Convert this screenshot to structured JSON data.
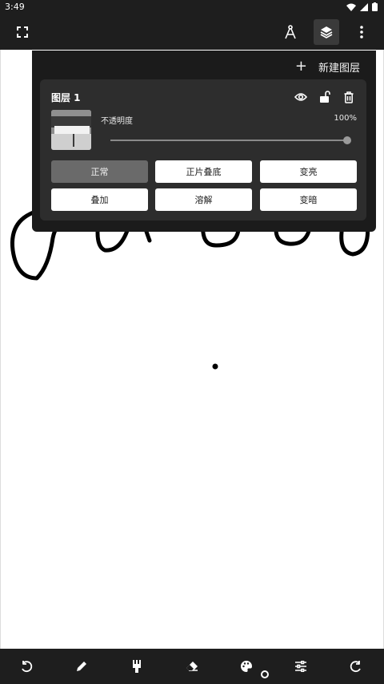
{
  "status_bar": {
    "time": "3:49"
  },
  "top_bar": {
    "fullscreen_icon": "fullscreen-icon",
    "compass_icon": "compass-icon",
    "layers_icon": "layers-icon",
    "more_icon": "more-vert-icon"
  },
  "layers_panel": {
    "new_layer_label": "新建图层",
    "new_layer_icon": "+",
    "layer": {
      "name": "图层 1",
      "opacity_label": "不透明度",
      "opacity_value": "100%",
      "opacity": 1.0,
      "visible_icon": "eye-icon",
      "lock_icon": "lock-open-icon",
      "delete_icon": "trash-icon"
    },
    "blend_modes": [
      {
        "label": "正常",
        "selected": true
      },
      {
        "label": "正片叠底",
        "selected": false
      },
      {
        "label": "变亮",
        "selected": false
      },
      {
        "label": "叠加",
        "selected": false
      },
      {
        "label": "溶解",
        "selected": false
      },
      {
        "label": "变暗",
        "selected": false
      }
    ]
  },
  "bottom_toolbar": {
    "tools": [
      "undo-icon",
      "pencil-icon",
      "brush-icon",
      "eraser-icon",
      "palette-icon",
      "sliders-icon",
      "redo-icon"
    ]
  },
  "colors": {
    "bar_bg": "#1e1e1e",
    "panel_bg": "#1b1b1b",
    "card_bg": "#2d2d2d",
    "selected_mode": "#6a6a6a"
  }
}
